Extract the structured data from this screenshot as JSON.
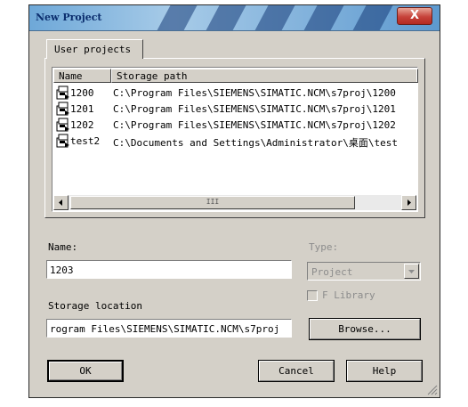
{
  "window": {
    "title": "New Project",
    "close_label": "X"
  },
  "tabs": [
    {
      "label": "User projects"
    }
  ],
  "list": {
    "columns": [
      "Name",
      "Storage path"
    ],
    "rows": [
      {
        "name": "1200",
        "path": "C:\\Program Files\\SIEMENS\\SIMATIC.NCM\\s7proj\\1200"
      },
      {
        "name": "1201",
        "path": "C:\\Program Files\\SIEMENS\\SIMATIC.NCM\\s7proj\\1201"
      },
      {
        "name": "1202",
        "path": "C:\\Program Files\\SIEMENS\\SIMATIC.NCM\\s7proj\\1202"
      },
      {
        "name": "test2",
        "path": "C:\\Documents and Settings\\Administrator\\桌面\\test"
      }
    ],
    "scroll_thumb_glyph": "III"
  },
  "form": {
    "name_label": "Name:",
    "name_value": "1203",
    "type_label": "Type:",
    "type_value": "Project",
    "library_label": "F Library",
    "storage_label": "Storage location",
    "storage_value": "rogram Files\\SIEMENS\\SIMATIC.NCM\\s7proj",
    "browse_label": "Browse..."
  },
  "buttons": {
    "ok": "OK",
    "cancel": "Cancel",
    "help": "Help"
  },
  "colors": {
    "dialog_bg": "#d4d0c8",
    "title_text": "#0b2e6e",
    "close_red": "#c6423a",
    "disabled_text": "#8c8c8c"
  }
}
